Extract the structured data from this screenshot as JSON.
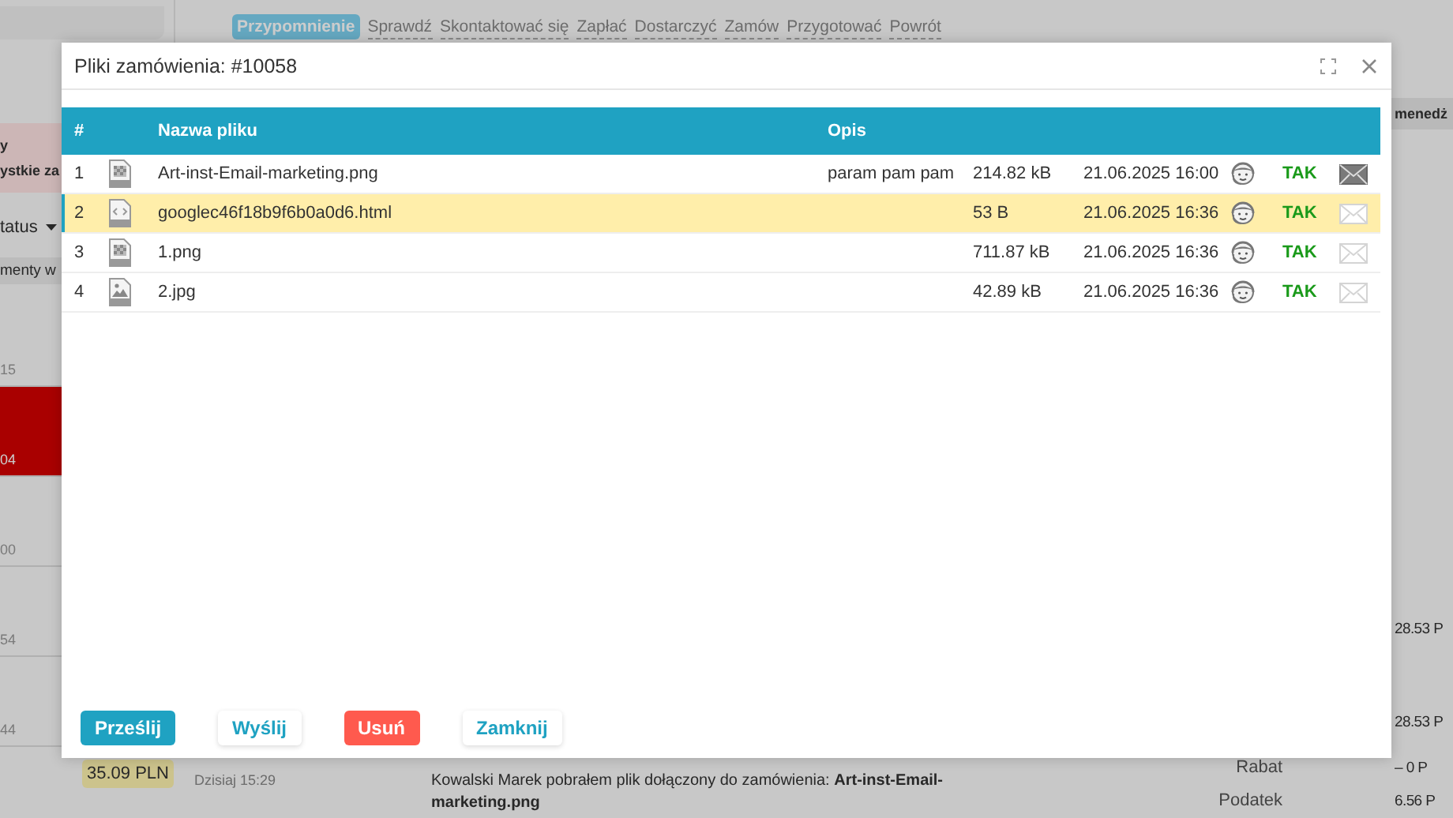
{
  "background": {
    "reminders": [
      {
        "label": "Przypomnienie",
        "selected": true
      },
      {
        "label": "Sprawdź",
        "selected": false
      },
      {
        "label": "Skontaktować się",
        "selected": false
      },
      {
        "label": "Zapłać",
        "selected": false
      },
      {
        "label": "Dostarczyć",
        "selected": false
      },
      {
        "label": "Zamów",
        "selected": false
      },
      {
        "label": "Przygotować",
        "selected": false
      },
      {
        "label": "Powrót",
        "selected": false
      }
    ],
    "sidebar": {
      "heading_fragment": "y",
      "filter_fragment": "ystkie za",
      "status_fragment": "tatus",
      "documents_fragment": "menty w",
      "orders": [
        {
          "time": "15",
          "selected": false
        },
        {
          "time": "04",
          "selected": true
        },
        {
          "time": "00",
          "selected": false
        },
        {
          "time": "54",
          "selected": false
        },
        {
          "time": "44",
          "selected": false
        }
      ],
      "price": "35.09 PLN"
    },
    "manager_fragment": "menedż",
    "totals": [
      "28.53 P",
      "28.53 P"
    ],
    "activity": {
      "time": "Dzisiaj 15:29",
      "message": "Kowalski Marek pobrałem plik dołączony do zamówienia: **Art-inst-Email-marketing.png**"
    },
    "summary": [
      {
        "label": "Rabat",
        "value": "– 0 P"
      },
      {
        "label": "Podatek",
        "value": "6.56 P"
      }
    ]
  },
  "dialog": {
    "title": "Pliki zamówienia: #10058",
    "table": {
      "columns": [
        {
          "label": "#",
          "kind": "index"
        },
        {
          "label": "Nazwa pliku",
          "kind": "name"
        },
        {
          "label": "Opis",
          "kind": "description"
        }
      ],
      "rows": [
        {
          "number": "1",
          "kind": "image",
          "name": "Art-inst-Email-marketing.png",
          "description": "param pam pam",
          "size": "214.82 kB",
          "date": "21.06.2025 16:00",
          "status": "TAK",
          "emailed": true,
          "selected": false
        },
        {
          "number": "2",
          "kind": "code",
          "name": "googlec46f18b9f6b0a0d6.html",
          "size": "53 B",
          "date": "21.06.2025 16:36",
          "status": "TAK",
          "emailed": false,
          "selected": true
        },
        {
          "number": "3",
          "kind": "image",
          "name": "1.png",
          "size": "711.87 kB",
          "date": "21.06.2025 16:36",
          "status": "TAK",
          "emailed": false,
          "selected": false
        },
        {
          "number": "4",
          "kind": "photo",
          "name": "2.jpg",
          "size": "42.89 kB",
          "date": "21.06.2025 16:36",
          "status": "TAK",
          "emailed": false,
          "selected": false
        }
      ]
    },
    "buttons": [
      {
        "label": "Prześlij",
        "kind": "primary"
      },
      {
        "label": "Wyślij",
        "kind": "secondary"
      },
      {
        "label": "Usuń",
        "kind": "danger"
      },
      {
        "label": "Zamknij",
        "kind": "secondary"
      }
    ]
  }
}
